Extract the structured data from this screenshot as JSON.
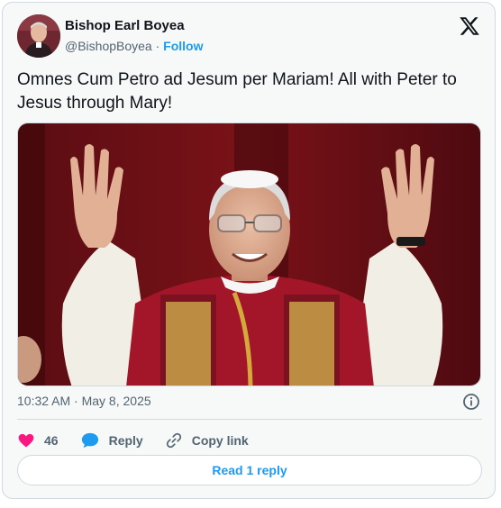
{
  "author": {
    "name": "Bishop Earl Boyea",
    "handle": "@BishopBoyea",
    "separator": "·",
    "follow_label": "Follow"
  },
  "tweet": {
    "text": "Omnes Cum Petro ad Jesum per Mariam! All with Peter to Jesus through Mary!",
    "timestamp": "10:32 AM · May 8, 2025"
  },
  "actions": {
    "like_count": "46",
    "reply_label": "Reply",
    "copy_label": "Copy link"
  },
  "read_replies_label": "Read 1 reply",
  "colors": {
    "accent": "#1d9bf0",
    "like": "#f91880",
    "secondary_text": "#536471",
    "border": "#cfd9de"
  }
}
